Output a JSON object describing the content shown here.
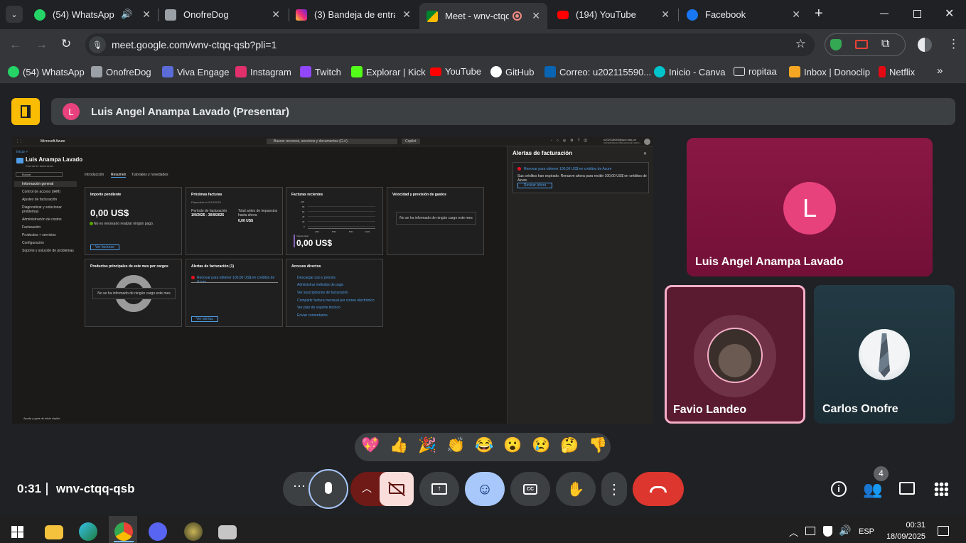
{
  "tabs": [
    {
      "label": "(54) WhatsApp",
      "color": "#25d366",
      "icon": "whatsapp-icon"
    },
    {
      "label": "OnofreDog",
      "color": "#9aa0a6",
      "icon": "page-icon"
    },
    {
      "label": "(3) Bandeja de entrad",
      "color": "#e1306c",
      "icon": "instagram-icon"
    },
    {
      "label": "Meet - wnv-ctqq",
      "color": "#00897b",
      "icon": "meet-icon"
    },
    {
      "label": "(194) YouTube",
      "color": "#ff0000",
      "icon": "youtube-icon"
    },
    {
      "label": "Facebook",
      "color": "#1877f2",
      "icon": "facebook-icon"
    }
  ],
  "url": "meet.google.com/wnv-ctqq-qsb?pli=1",
  "bookmarks": [
    {
      "label": "(54) WhatsApp",
      "color": "#25d366"
    },
    {
      "label": "OnofreDog",
      "color": "#9aa0a6"
    },
    {
      "label": "Viva Engage",
      "color": "#5b6bd8"
    },
    {
      "label": "Instagram",
      "color": "#e1306c"
    },
    {
      "label": "Twitch",
      "color": "#9146ff"
    },
    {
      "label": "Explorar | Kick",
      "color": "#53fc18"
    },
    {
      "label": "YouTube",
      "color": "#ff0000"
    },
    {
      "label": "GitHub",
      "color": "#ffffff"
    },
    {
      "label": "Correo: u202115590...",
      "color": "#0a64b4"
    },
    {
      "label": "Inicio - Canva",
      "color": "#00c4cc"
    },
    {
      "label": "ropitaa",
      "color": "#9aa0a6"
    },
    {
      "label": "Inbox | Donoclip",
      "color": "#f5a623"
    },
    {
      "label": "Netflix",
      "color": "#e50914"
    }
  ],
  "presenter": {
    "initial": "L",
    "label": "Luis Angel Anampa Lavado (Presentar)"
  },
  "azure": {
    "topbar_title": "Microsoft Azure",
    "search": "Buscar recursos, servicios y documentos (G+/)",
    "copilot": "Copilot",
    "account": "u202115640@upc.edu.pe",
    "account_sub": "UNIVERSIDAD PERUANA DE CIENC...",
    "breadcrumb": "Inicio >",
    "page_title": "Luis Anampa Lavado",
    "page_sub": "Cuenta de facturación",
    "search_placeholder": "Buscar",
    "nav": [
      "Información general",
      "Control de acceso (IAM)",
      "Ajustes de facturación",
      "Diagnosticar y solucionar problemas",
      "Administración de costos",
      "Facturación",
      "Productos + servicios",
      "Configuración",
      "Soporte y solución de problemas"
    ],
    "tabs": [
      "Introducción",
      "Resumen",
      "Tutoriales y novedades"
    ],
    "card1": {
      "title": "Importe pendiente",
      "amount": "0,00 US$",
      "note": "No es necesario realizar ningún pago.",
      "button": "Ver facturas"
    },
    "card2": {
      "title": "Próximas facturas",
      "sub": "Disponible el 9/10/2025",
      "period_label": "Período de facturación",
      "period": "1/9/2025 - 30/9/2025",
      "total_label": "Total antes de impuestos hasta ahora",
      "total": "0,00 US$"
    },
    "card3": {
      "title": "Facturas recientes",
      "axis": [
        "100",
        "80",
        "60",
        "40",
        "20",
        "0"
      ],
      "months": [
        "4/24",
        "5/24",
        "6/24",
        "11/24"
      ],
      "label": "Importe total",
      "amount": "0,00 US$"
    },
    "card4": {
      "title": "Velocidad y previsión de gastos",
      "empty": "No se ha informado de ningún cargo este mes"
    },
    "card5": {
      "title": "Productos principales de este mes por cargos",
      "empty": "No se ha informado de ningún cargo este mes"
    },
    "card6": {
      "title": "Alertas de facturación (1)",
      "alert": "Renovar para obtener 100,00 US$ en créditos de Azure",
      "button": "Ver alertas"
    },
    "card7": {
      "title": "Accesos directos",
      "links": [
        "Descargar uso y precios",
        "Administrar métodos de pago",
        "Ver suscripciones de facturación",
        "Compartir factura mensual por correo electrónico",
        "Ver plan de soporte técnico",
        "Enviar comentarios"
      ]
    },
    "panel": {
      "title": "Alertas de facturación",
      "alert_title": "Renovar para obtener 100,00 US$ en créditos de Azure",
      "alert_body": "Sus créditos han expirado. Renueve ahora para recibir 100,00 US$ en créditos de Azure.",
      "button": "Revisar ahora"
    },
    "footer": "Ayuda y guía de inicio rápido"
  },
  "participants": [
    {
      "name": "Luis Angel Anampa Lavado",
      "initial": "L"
    },
    {
      "name": "Favio Landeo"
    },
    {
      "name": "Carlos Onofre"
    }
  ],
  "reactions": [
    "💖",
    "👍",
    "🎉",
    "👏",
    "😂",
    "😮",
    "😢",
    "🤔",
    "👎"
  ],
  "meeting": {
    "time": "0:31",
    "code": "wnv-ctqq-qsb",
    "people_count": "4"
  },
  "taskbar": {
    "lang": "ESP",
    "time": "00:31",
    "date": "18/09/2025"
  }
}
